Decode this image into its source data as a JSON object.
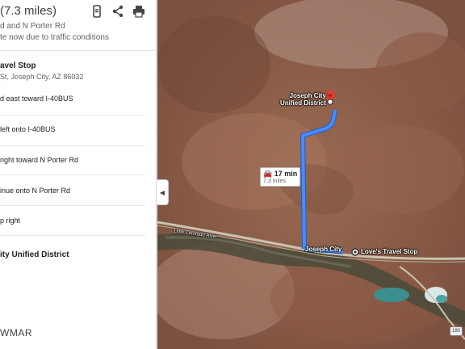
{
  "header": {
    "distance": "(7.3 miles)",
    "via": "d and N Porter Rd",
    "traffic_note": "te now due to traffic conditions"
  },
  "header_icons": [
    "mobile-send-icon",
    "share-icon",
    "print-icon"
  ],
  "origin": {
    "name": "avel Stop",
    "address": "St, Joseph City, AZ 86032"
  },
  "steps": [
    {
      "text": "d east toward I-40BUS"
    },
    {
      "text": "left onto I-40BUS"
    },
    {
      "text": "right toward N Porter Rd"
    },
    {
      "text": "inue onto N Porter Rd"
    },
    {
      "text": "p right"
    }
  ],
  "destination": {
    "name": "ity Unified District"
  },
  "brand": "WMAR",
  "map": {
    "route_badge": {
      "time": "17 min",
      "distance": "7.3 miles"
    },
    "labels": {
      "destination": "Joseph City\nUnified District",
      "town": "Joseph City",
      "origin": "Love's Travel Stop",
      "river": "Little Colorado River",
      "highway": "180"
    },
    "colors": {
      "route": "#4a8cf7",
      "pin": "#e03c2f"
    }
  }
}
